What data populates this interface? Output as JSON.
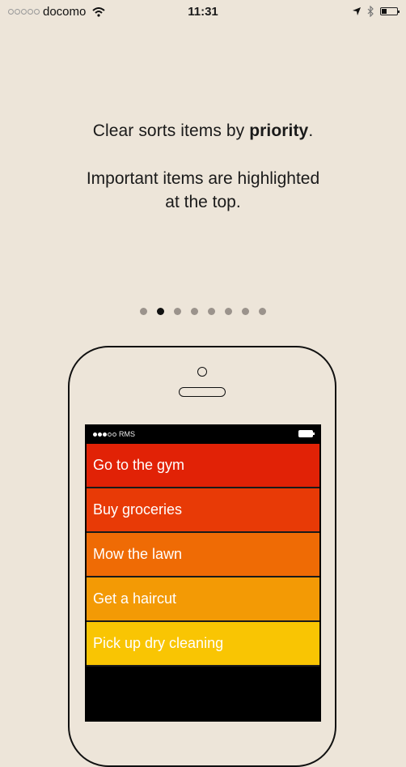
{
  "status_bar": {
    "carrier": "docomo",
    "signal_bars_total": 5,
    "signal_bars_filled": 0,
    "time": "11:31",
    "battery_percent": 35
  },
  "onboarding": {
    "headline_prefix": "Clear sorts items by ",
    "headline_bold": "priority",
    "headline_suffix": ".",
    "subline_1": "Important items are highlighted",
    "subline_2": "at the top.",
    "page_count": 8,
    "current_page": 2
  },
  "phone_mock": {
    "carrier": "RMS",
    "items": [
      {
        "label": "Go to the gym",
        "color": "#e12206"
      },
      {
        "label": "Buy groceries",
        "color": "#e83a06"
      },
      {
        "label": "Mow the lawn",
        "color": "#ef6b05"
      },
      {
        "label": "Get a haircut",
        "color": "#f39a05"
      },
      {
        "label": "Pick up dry cleaning",
        "color": "#f9c503"
      }
    ]
  }
}
